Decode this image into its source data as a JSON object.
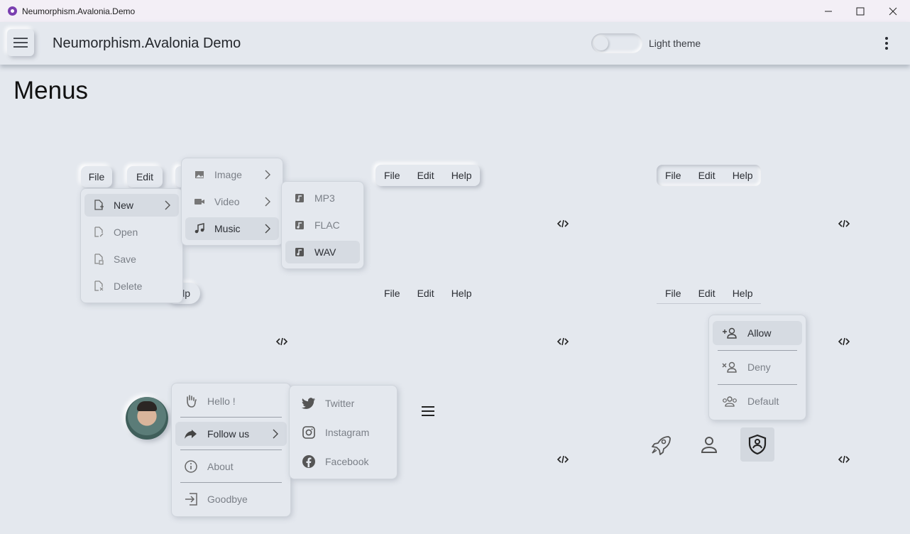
{
  "window": {
    "title": "Neumorphism.Avalonia.Demo",
    "minimize_glyph": "—",
    "maximize_glyph": "☐",
    "close_glyph": "✕"
  },
  "appbar": {
    "title": "Neumorphism.Avalonia Demo",
    "theme_toggle_label": "Light theme",
    "theme_toggle_on": false
  },
  "page": {
    "title": "Menus"
  },
  "menu1": {
    "items": [
      "File",
      "Edit",
      "Help"
    ],
    "partial_help": "lp",
    "file_menu": [
      {
        "label": "New",
        "icon": "file-plus-icon",
        "has_submenu": true,
        "active": true
      },
      {
        "label": "Open",
        "icon": "file-edit-icon"
      },
      {
        "label": "Save",
        "icon": "file-save-icon"
      },
      {
        "label": "Delete",
        "icon": "file-delete-icon"
      }
    ],
    "new_submenu": [
      {
        "label": "Image",
        "icon": "image-icon",
        "has_submenu": true
      },
      {
        "label": "Video",
        "icon": "video-icon",
        "has_submenu": true
      },
      {
        "label": "Music",
        "icon": "music-icon",
        "has_submenu": true,
        "active": true
      }
    ],
    "music_submenu": [
      {
        "label": "MP3",
        "icon": "music-file-icon"
      },
      {
        "label": "FLAC",
        "icon": "music-file-icon"
      },
      {
        "label": "WAV",
        "icon": "music-file-icon",
        "active": true
      }
    ]
  },
  "menu2": {
    "items": [
      "File",
      "Edit",
      "Help"
    ]
  },
  "menu3": {
    "items": [
      "File",
      "Edit",
      "Help"
    ]
  },
  "menu4": {
    "items": [
      "File",
      "Edit",
      "Help"
    ]
  },
  "menu5": {
    "items": [
      "File",
      "Edit",
      "Help"
    ]
  },
  "permission_menu": [
    {
      "label": "Allow",
      "icon": "account-plus-icon",
      "active": true
    },
    {
      "label": "Deny",
      "icon": "account-remove-icon"
    },
    {
      "label": "Default",
      "icon": "account-group-icon"
    }
  ],
  "context_menu": [
    {
      "label": "Hello !",
      "icon": "hand-wave-icon"
    },
    {
      "label": "Follow us",
      "icon": "share-icon",
      "has_submenu": true,
      "active": true
    },
    {
      "label": "About",
      "icon": "info-icon"
    },
    {
      "label": "Goodbye",
      "icon": "exit-icon"
    }
  ],
  "social_submenu": [
    {
      "label": "Twitter",
      "icon": "twitter-icon"
    },
    {
      "label": "Instagram",
      "icon": "instagram-icon"
    },
    {
      "label": "Facebook",
      "icon": "facebook-icon"
    }
  ],
  "icon_buttons": [
    {
      "name": "rocket-icon",
      "selected": false
    },
    {
      "name": "account-icon",
      "selected": false
    },
    {
      "name": "shield-account-icon",
      "selected": true
    }
  ],
  "colors": {
    "background": "#e4e8ee",
    "active_item": "#d6dbe2",
    "text": "#2a2d33",
    "muted_text": "#7a7f87"
  }
}
